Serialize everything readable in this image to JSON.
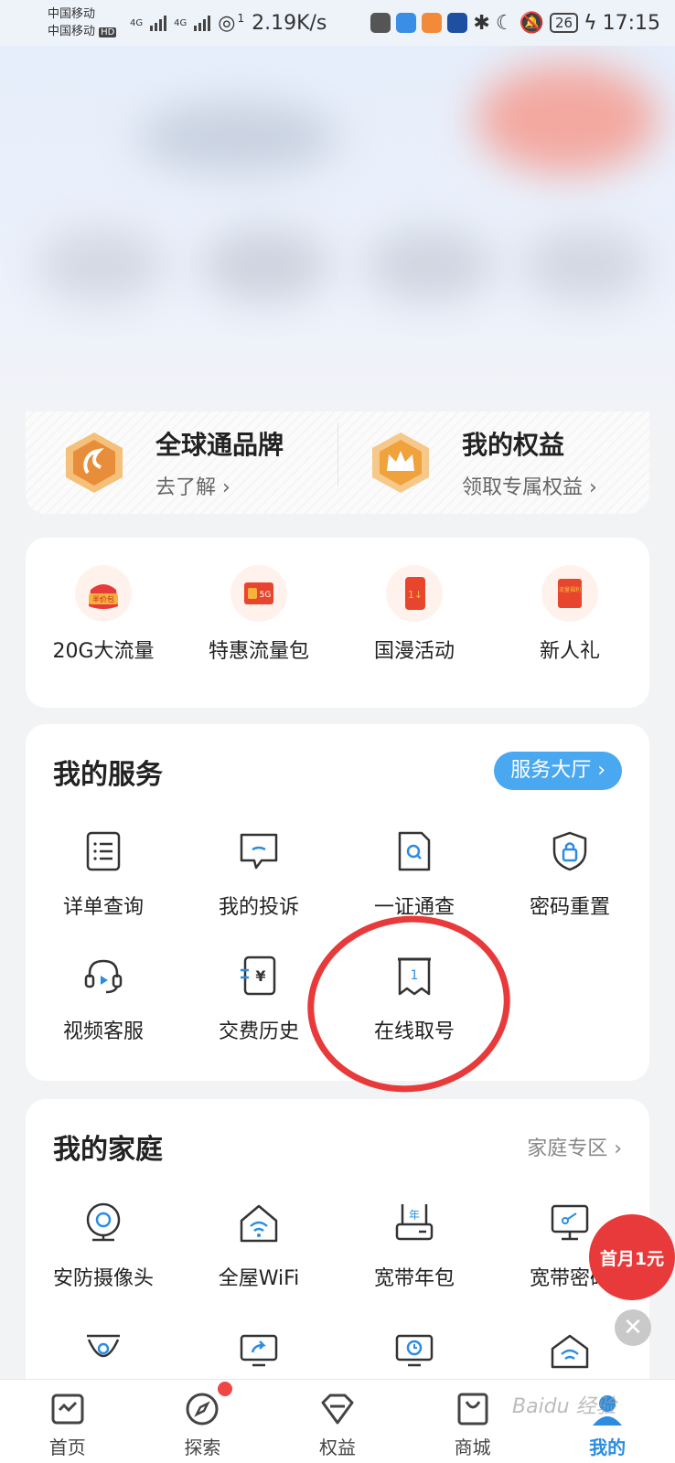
{
  "status_bar": {
    "carrier1": "中国移动",
    "carrier2": "中国移动",
    "hd": "HD",
    "net1": "4G",
    "net2": "4G",
    "hotspot_count": "1",
    "speed": "2.19K/s",
    "battery": "26",
    "time": "17:15"
  },
  "brand": {
    "left_title": "全球通品牌",
    "left_sub": "去了解 ›",
    "right_title": "我的权益",
    "right_sub": "领取专属权益 ›"
  },
  "promos": [
    {
      "label": "20G大流量",
      "badge": "半价包"
    },
    {
      "label": "特惠流量包",
      "badge": "5G"
    },
    {
      "label": "国漫活动",
      "badge": "1↓"
    },
    {
      "label": "新人礼",
      "badge": "流量福利"
    }
  ],
  "services": {
    "title": "我的服务",
    "hall_button": "服务大厅 ›",
    "items": [
      {
        "label": "详单查询"
      },
      {
        "label": "我的投诉"
      },
      {
        "label": "一证通查"
      },
      {
        "label": "密码重置"
      },
      {
        "label": "视频客服"
      },
      {
        "label": "交费历史"
      },
      {
        "label": "在线取号",
        "glyph": "1"
      }
    ]
  },
  "family": {
    "title": "我的家庭",
    "zone_link": "家庭专区 ›",
    "items": [
      {
        "label": "安防摄像头"
      },
      {
        "label": "全屋WiFi"
      },
      {
        "label": "宽带年包",
        "glyph": "年"
      },
      {
        "label": "宽带密码"
      }
    ]
  },
  "float_promo": {
    "text": "首月1元",
    "close": "✕"
  },
  "tabs": [
    {
      "label": "首页"
    },
    {
      "label": "探索"
    },
    {
      "label": "权益"
    },
    {
      "label": "商城"
    },
    {
      "label": "我的"
    }
  ],
  "watermark": "Baidu 经验",
  "colors": {
    "accent": "#4aa8f0",
    "highlight": "#e83a3a",
    "active_tab": "#2c8de0"
  }
}
